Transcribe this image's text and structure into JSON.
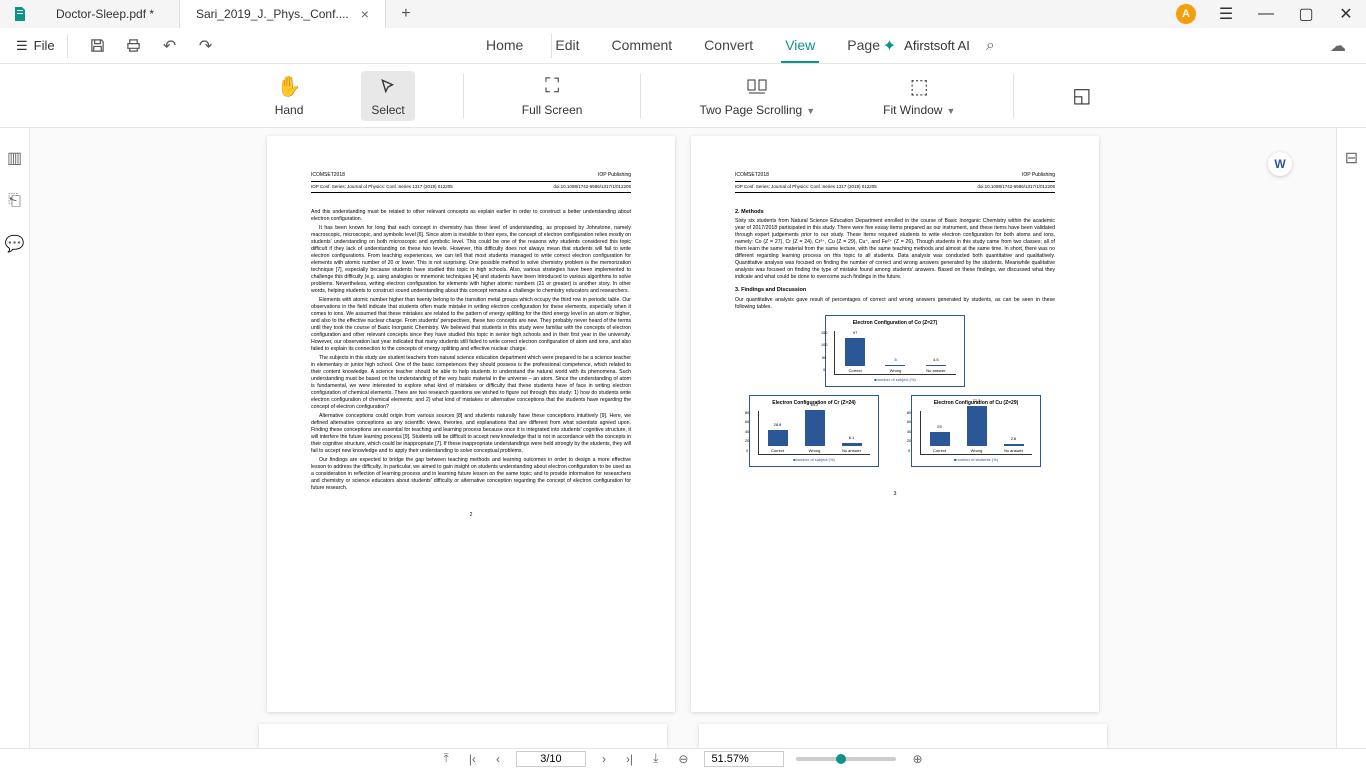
{
  "tabs": [
    {
      "title": "Doctor-Sleep.pdf *",
      "active": false
    },
    {
      "title": "Sari_2019_J._Phys._Conf....",
      "active": true
    }
  ],
  "avatar_letter": "A",
  "menu": {
    "file": "File"
  },
  "main_tabs": [
    "Home",
    "Edit",
    "Comment",
    "Convert",
    "View",
    "Page"
  ],
  "active_main_tab": "View",
  "ai_label": "Afirstsoft AI",
  "tools": {
    "hand": "Hand",
    "select": "Select",
    "fullscreen": "Full Screen",
    "two_page": "Two Page Scrolling",
    "fit_window": "Fit Window"
  },
  "page_header": {
    "conf": "ICOMSET2018",
    "pub": "IOP Publishing"
  },
  "page_subheader": {
    "series": "IOP Conf. Series: Journal of Physics: Conf. Series 1317 (2019) 012205",
    "doi": "doi:10.1088/1742-6596/1317/1/012205"
  },
  "page2": {
    "p1": "And this understanding must be related to other relevant concepts as explain earlier in order to construct a better understanding about electron configuration.",
    "p2": "It has been known for long that each concept in chemistry has three level of understanding, as proposed by Johnstone, namely macroscopic, microscopic, and symbolic level [6]. Since atom is invisible to their eyes, the concept of electron configuration relies mostly on students' understanding on both microscopic and symbolic level. This could be one of the reasons why students considered this topic difficult if they lack of understanding on these two levels. However, this difficulty does not always mean that students will fail to write electron configurations. From teaching experiences, we can tell that most students managed to write correct electron configuration for elements with atomic number of 20 or lower. This is not surprising. One possible method to solve chemistry problem is the memorization technique [7], especially because students have studied this topic in high schools. Also, various strategies have been implemented to challenge this difficulty (e.g. using analogies or mnemonic techniques [4] and students have been introduced to various algorithms to solve problems. Nevertheless, writing electron configuration for elements with higher atomic numbers (21 or greater) is another story. In other words, helping students to construct sound understanding about this concept remains a challenge to chemistry educators and researchers.",
    "p3": "Elements with atomic number higher than twenty belong to the transition metal groups which occupy the third row in periodic table. Our observations in the field indicate that students often made mistake in writing electron configuration for these elements, especially when it comes to ions. We assumed that these mistakes are related to the pattern of energy splitting for the third energy level in an atom or higher, and also to the effective nuclear charge. From students' perspectives, these two concepts are new. They probably never heard of the terms until they took the course of Basic Inorganic Chemistry. We believed that students in this study were familiar with the concepts of electron configuration and other relevant concepts since they have studied this topic in senior high schools and in their first year in the university. However, our observation last year indicated that many students still failed to write correct electron configuration of atom and ions, and also failed to explain its connection to the concepts of energy splitting and effective nuclear charge.",
    "p4": "The subjects in this study are student teachers from natural science education department which were prepared to be a science teacher in elementary or junior high school. One of the basic competences they should possess is the professional competence, which related to their content knowledge. A science teacher should be able to help students to understand the natural world with its phenomena. Such understanding must be based on the understanding of the very basic material in the universe – an atom. Since the understanding of atom is fundamental, we were interested to explore what kind of mistakes or difficulty that these students have of face in writing electron configuration of chemical elements. There are two research questions we wished to figure out through this study: 1) how do students write electron configuration of chemical elements; and 2) what kind of mistakes or alternative conceptions that the students have regarding the concept of electron configuration?",
    "p5": "Alternative conceptions could origin from various sources [8] and students naturally have these conceptions intuitively [9]. Here, we defined alternative conceptions as any scientific views, theories, and explanations that are different from what scientists agreed upon. Finding these conceptions are essential for teaching and learning process because once it is integrated into students' cognitive structure, it will interfere the future learning process [9]. Students will be difficult to accept new knowledge that is not in accordance with the concepts in their cognitive structure, which could be inappropriate [7]. If these inappropriate understandings were held strongly by the students, they will fail to accept new knowledge and to apply their understanding to solve conceptual problems.",
    "p6": "Our findings are expected to bridge the gap between teaching methods and learning outcomes in order to design a more effective lesson to address the difficulty. In particular, we aimed to gain insight on students understanding about electron configuration to be used as a consideration in reflection of learning process and in learning future lesson on the same topic; and to provide information for researchers and chemistry or science educators about students' difficulty or alternative conception regarding the concept of electron configuration for future research.",
    "num": "2"
  },
  "page3": {
    "h2": "2. Methods",
    "p1": "Sixty six students from Natural Science Education Department enrolled in the course of Basic Inorganic Chemistry within the academic year of 2017/2018 participated in this study. There were five essay items prepared as our instrument, and these items have been validated through expert judgements prior to our study. These items required students to write electron configuration for both atoms and ions, namely: Co (Z = 27), Cr (Z = 24), Cr²⁺, Cu (Z = 29), Cu⁺, and Fe²⁺ (Z = 26). Though students in this study came from two classes; all of them learn the same material from the same lecture, with the same teaching methods and almost at the same time. In short, there was no different regarding learning process on this topic to all students. Data analysis was conducted both quantitative and qualitatively. Quantitative analysis was focused on finding the number of correct and wrong answers generated by the students. Meanwhile qualitative analysis was focused on finding the type of mistake found among students' answers. Based on these findings, we discussed what they indicate and what could be done to overcome such findings in the future.",
    "h3": "3. Findings and Discussion",
    "p2": "Our quantitative analysis gave result of percentages of correct and wrong answers generated by students, as can be seen in these following tables.",
    "num": "3"
  },
  "chart_data": [
    {
      "type": "bar",
      "title": "Electron Configuration of Co (Z=27)",
      "categories": [
        "Correct",
        "Wrong",
        "No answer"
      ],
      "values": [
        97.0,
        3.0,
        4.5
      ],
      "ylim": [
        0,
        150
      ],
      "yticks": [
        0.0,
        50.0,
        100.0,
        150.0
      ],
      "legend": "number of subject (%)"
    },
    {
      "type": "bar",
      "title": "Electron Configuration of Cr (Z=24)",
      "categories": [
        "Correct",
        "Wrong",
        "No answer"
      ],
      "values": [
        28.8,
        65.2,
        6.1
      ],
      "ylim": [
        0,
        80
      ],
      "yticks": [
        0.0,
        20.0,
        40.0,
        60.0,
        80.0
      ],
      "legend": "number of subject (%)"
    },
    {
      "type": "bar",
      "title": "Electron Configuration of Cu (Z=29)",
      "categories": [
        "Correct",
        "Wrong",
        "No answer"
      ],
      "values": [
        25.0,
        72.2,
        2.8
      ],
      "ylim": [
        0,
        80
      ],
      "yticks": [
        0.0,
        20.0,
        40.0,
        60.0,
        80.0
      ],
      "legend": "number of students (%)"
    }
  ],
  "status": {
    "page_display": "3/10",
    "zoom": "51.57%"
  }
}
